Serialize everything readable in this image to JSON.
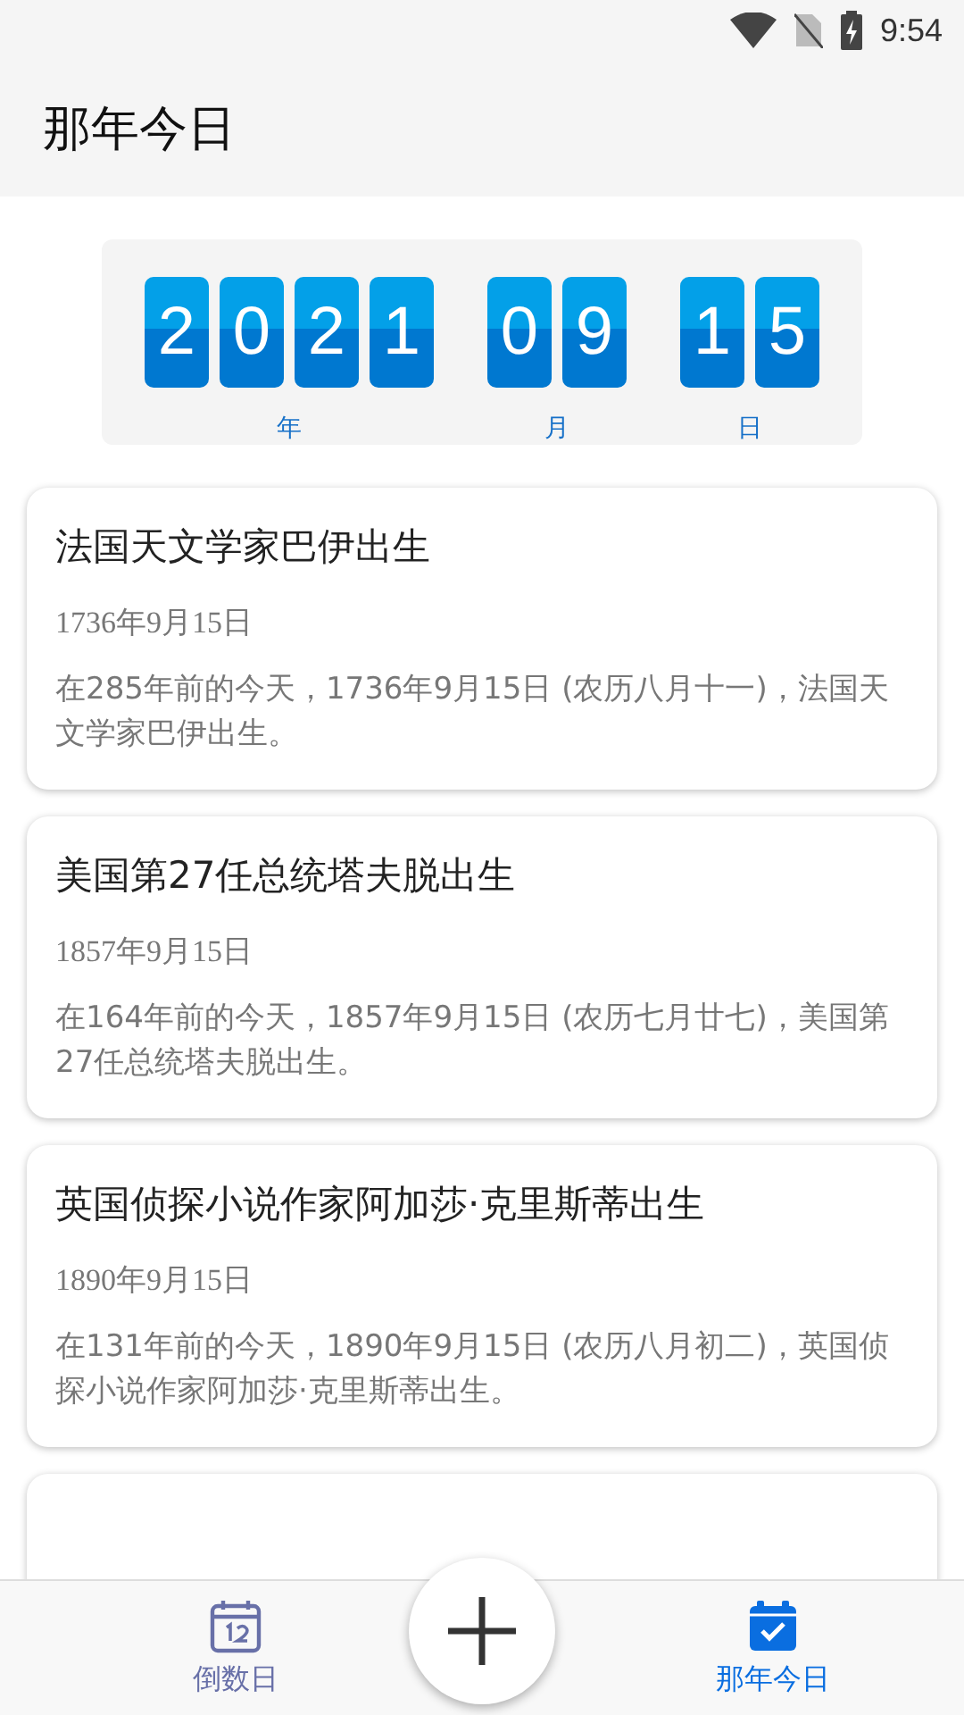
{
  "status_bar": {
    "time": "9:54"
  },
  "app_bar": {
    "title": "那年今日"
  },
  "date_counter": {
    "groups": [
      {
        "digits": [
          "2",
          "0",
          "2",
          "1"
        ],
        "label": "年"
      },
      {
        "digits": [
          "0",
          "9"
        ],
        "label": "月"
      },
      {
        "digits": [
          "1",
          "5"
        ],
        "label": "日"
      }
    ]
  },
  "events": [
    {
      "title": "法国天文学家巴伊出生",
      "date": "1736年9月15日",
      "description": "在285年前的今天，1736年9月15日 (农历八月十一)，法国天文学家巴伊出生。"
    },
    {
      "title": "美国第27任总统塔夫脱出生",
      "date": "1857年9月15日",
      "description": "在164年前的今天，1857年9月15日 (农历七月廿七)，美国第27任总统塔夫脱出生。"
    },
    {
      "title": "英国侦探小说作家阿加莎·克里斯蒂出生",
      "date": "1890年9月15日",
      "description": "在131年前的今天，1890年9月15日 (农历八月初二)，英国侦探小说作家阿加莎·克里斯蒂出生。"
    }
  ],
  "bottom_nav": [
    {
      "label": "倒数日",
      "kind": "countdown",
      "selected": false
    },
    {
      "label": "那年今日",
      "kind": "history",
      "selected": true
    }
  ]
}
